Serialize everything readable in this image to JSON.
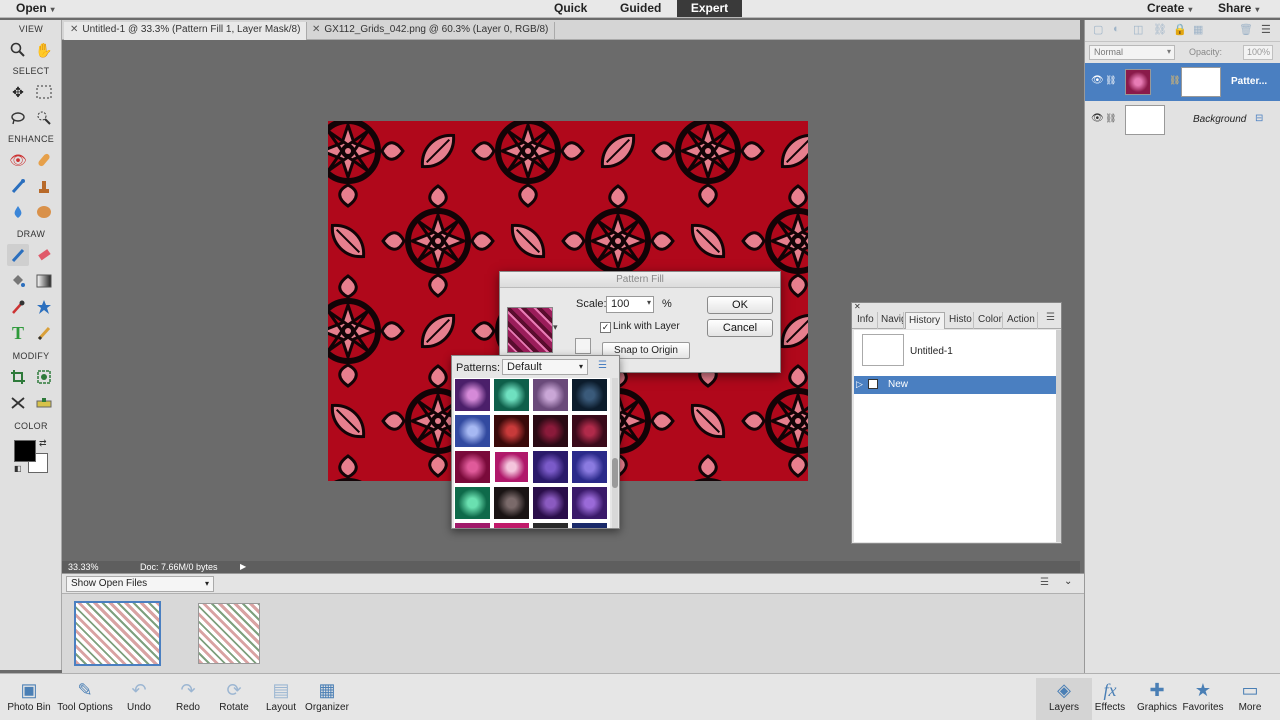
{
  "topbar": {
    "open_label": "Open",
    "modes": [
      "Quick",
      "Guided",
      "Expert"
    ],
    "active_mode": "Expert",
    "create_label": "Create",
    "share_label": "Share"
  },
  "tabs": [
    {
      "label": "Untitled-1 @ 33.3% (Pattern Fill 1, Layer Mask/8)",
      "active": true
    },
    {
      "label": "GX112_Grids_042.png @ 60.3% (Layer 0, RGB/8)",
      "active": false
    }
  ],
  "toolbox": {
    "sections": [
      "VIEW",
      "SELECT",
      "ENHANCE",
      "DRAW",
      "MODIFY",
      "COLOR"
    ],
    "foreground_color": "#000000",
    "background_color": "#ffffff"
  },
  "status": {
    "zoom": "33.33%",
    "doc_info": "Doc: 7.66M/0 bytes"
  },
  "photo_bin": {
    "show_label": "Show Open Files"
  },
  "bottombar": [
    {
      "label": "Photo Bin",
      "icon": "photo-bin-icon"
    },
    {
      "label": "Tool Options",
      "icon": "tool-options-icon"
    },
    {
      "label": "Undo",
      "icon": "undo-icon"
    },
    {
      "label": "Redo",
      "icon": "redo-icon"
    },
    {
      "label": "Rotate",
      "icon": "rotate-icon"
    },
    {
      "label": "Layout",
      "icon": "layout-icon"
    },
    {
      "label": "Organizer",
      "icon": "organizer-icon"
    },
    {
      "label": "Layers",
      "icon": "layers-icon"
    },
    {
      "label": "Effects",
      "icon": "effects-icon"
    },
    {
      "label": "Graphics",
      "icon": "graphics-icon"
    },
    {
      "label": "Favorites",
      "icon": "favorites-icon"
    },
    {
      "label": "More",
      "icon": "more-icon"
    }
  ],
  "layers": {
    "blend_mode": "Normal",
    "opacity_label": "Opacity:",
    "opacity_value": "100%",
    "items": [
      {
        "name": "Patter...",
        "selected": true
      },
      {
        "name": "Background",
        "selected": false
      }
    ]
  },
  "dialog": {
    "title": "Pattern Fill",
    "scale_label": "Scale:",
    "scale_value": "100",
    "percent": "%",
    "link_label": "Link with Layer",
    "snap_label": "Snap to Origin",
    "ok_label": "OK",
    "cancel_label": "Cancel"
  },
  "patterns": {
    "label": "Patterns:",
    "selected": "Default"
  },
  "history_panel": {
    "tabs": [
      "Info",
      "Navig",
      "History",
      "Histo",
      "Color",
      "Action"
    ],
    "active_tab": "History",
    "snapshot": "Untitled-1",
    "states": [
      "New"
    ]
  },
  "colors": {
    "accent": "#4a7fc1",
    "canvas_red": "#b0081b"
  }
}
